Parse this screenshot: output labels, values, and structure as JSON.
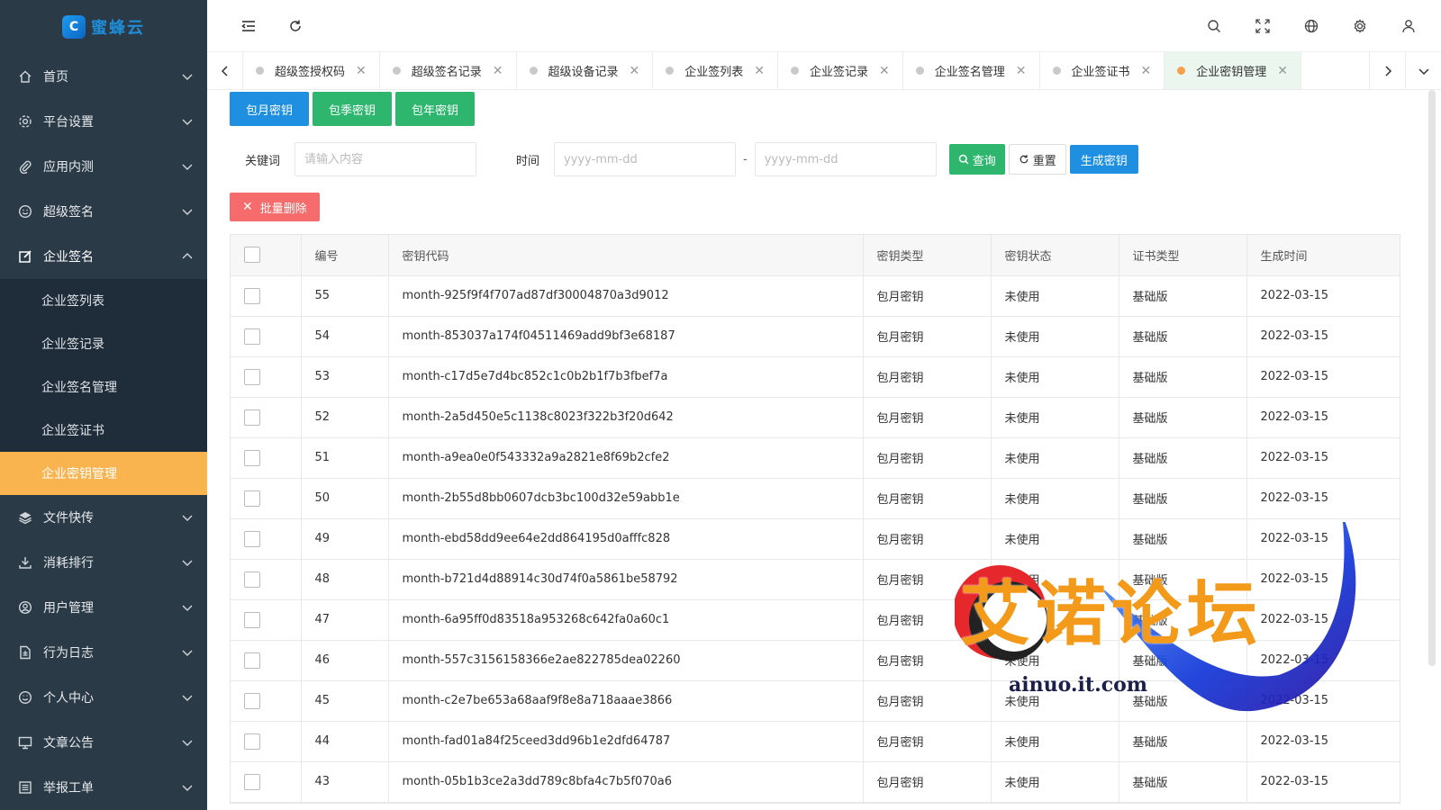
{
  "sidebar": {
    "logo_text": "蜜蜂云",
    "menu": [
      {
        "label": "首页",
        "icon": "home-icon"
      },
      {
        "label": "平台设置",
        "icon": "gear-icon"
      },
      {
        "label": "应用内测",
        "icon": "paperclip-icon"
      },
      {
        "label": "超级签名",
        "icon": "smile-icon"
      },
      {
        "label": "企业签名",
        "icon": "edit-icon",
        "open": true
      },
      {
        "label": "文件快传",
        "icon": "layers-icon"
      },
      {
        "label": "消耗排行",
        "icon": "download-icon"
      },
      {
        "label": "用户管理",
        "icon": "user-circle-icon"
      },
      {
        "label": "行为日志",
        "icon": "file-icon"
      },
      {
        "label": "个人中心",
        "icon": "face-icon"
      },
      {
        "label": "文章公告",
        "icon": "monitor-icon"
      },
      {
        "label": "举报工单",
        "icon": "list-icon"
      }
    ],
    "submenu": [
      {
        "label": "企业签列表"
      },
      {
        "label": "企业签记录"
      },
      {
        "label": "企业签名管理"
      },
      {
        "label": "企业签证书"
      },
      {
        "label": "企业密钥管理",
        "active": true
      }
    ]
  },
  "tabs": [
    {
      "label": "超级签授权码"
    },
    {
      "label": "超级签名记录"
    },
    {
      "label": "超级设备记录"
    },
    {
      "label": "企业签列表"
    },
    {
      "label": "企业签记录"
    },
    {
      "label": "企业签名管理"
    },
    {
      "label": "企业签证书"
    },
    {
      "label": "企业密钥管理",
      "active": true
    }
  ],
  "actions": {
    "monthly": "包月密钥",
    "quarterly": "包季密钥",
    "yearly": "包年密钥"
  },
  "search": {
    "keyword_label": "关键词",
    "keyword_placeholder": "请输入内容",
    "time_label": "时间",
    "date_placeholder": "yyyy-mm-dd",
    "dash": "-",
    "query": "查询",
    "reset": "重置",
    "generate": "生成密钥"
  },
  "batch_delete": "批量删除",
  "table": {
    "columns": [
      "编号",
      "密钥代码",
      "密钥类型",
      "密钥状态",
      "证书类型",
      "生成时间"
    ],
    "rows": [
      [
        "55",
        "month-925f9f4f707ad87df30004870a3d9012",
        "包月密钥",
        "未使用",
        "基础版",
        "2022-03-15"
      ],
      [
        "54",
        "month-853037a174f04511469add9bf3e68187",
        "包月密钥",
        "未使用",
        "基础版",
        "2022-03-15"
      ],
      [
        "53",
        "month-c17d5e7d4bc852c1c0b2b1f7b3fbef7a",
        "包月密钥",
        "未使用",
        "基础版",
        "2022-03-15"
      ],
      [
        "52",
        "month-2a5d450e5c1138c8023f322b3f20d642",
        "包月密钥",
        "未使用",
        "基础版",
        "2022-03-15"
      ],
      [
        "51",
        "month-a9ea0e0f543332a9a2821e8f69b2cfe2",
        "包月密钥",
        "未使用",
        "基础版",
        "2022-03-15"
      ],
      [
        "50",
        "month-2b55d8bb0607dcb3bc100d32e59abb1e",
        "包月密钥",
        "未使用",
        "基础版",
        "2022-03-15"
      ],
      [
        "49",
        "month-ebd58dd9ee64e2dd864195d0afffc828",
        "包月密钥",
        "未使用",
        "基础版",
        "2022-03-15"
      ],
      [
        "48",
        "month-b721d4d88914c30d74f0a5861be58792",
        "包月密钥",
        "未使用",
        "基础版",
        "2022-03-15"
      ],
      [
        "47",
        "month-6a95ff0d83518a953268c642fa0a60c1",
        "包月密钥",
        "未使用",
        "基础版",
        "2022-03-15"
      ],
      [
        "46",
        "month-557c3156158366e2ae822785dea02260",
        "包月密钥",
        "未使用",
        "基础版",
        "2022-03-15"
      ],
      [
        "45",
        "month-c2e7be653a68aaf9f8e8a718aaae3866",
        "包月密钥",
        "未使用",
        "基础版",
        "2022-03-15"
      ],
      [
        "44",
        "month-fad01a84f25ceed3dd96b1e2dfd64787",
        "包月密钥",
        "未使用",
        "基础版",
        "2022-03-15"
      ],
      [
        "43",
        "month-05b1b3ce2a3dd789c8bfa4c7b5f070a6",
        "包月密钥",
        "未使用",
        "基础版",
        "2022-03-15"
      ]
    ]
  },
  "watermark": {
    "title": "艾诺论坛",
    "url": "ainuo.it.com"
  },
  "colors": {
    "sidebar_bg": "#2b3a47",
    "active_orange": "#f9b34f",
    "primary_blue": "#1e8fe1",
    "success_green": "#2eb66f",
    "danger_red": "#f66b6b"
  }
}
